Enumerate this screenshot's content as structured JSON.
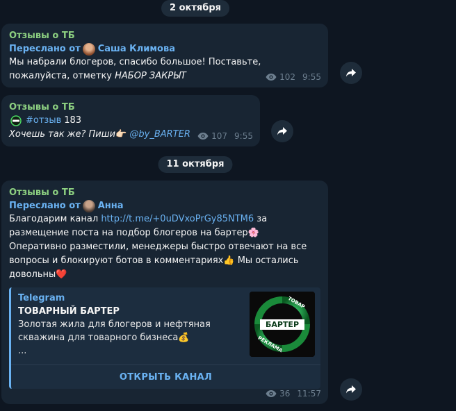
{
  "dates": [
    "2 октября",
    "11 октября"
  ],
  "messages": [
    {
      "sender": "Отзывы о ТБ",
      "forwarded_prefix": "Переслано от",
      "forwarded_name": "Саша Климова",
      "text_plain": "Мы набрали блогеров, спасибо большое! Поставьте, пожалуйста, отметку ",
      "text_italic": "НАБОР ЗАКРЫТ",
      "views": "102",
      "time": "9:55"
    },
    {
      "sender": "Отзывы о ТБ",
      "hashtag": "#отзыв",
      "number": "183",
      "italic_text": "Хочешь так же? Пиши",
      "emoji": "👉🏻",
      "mention": "@by_BARTER",
      "views": "107",
      "time": "9:55"
    },
    {
      "sender": "Отзывы о ТБ",
      "forwarded_prefix": "Переслано от",
      "forwarded_name": "Анна",
      "text_before_link": "Благодарим канал ",
      "link": "http://t.me/+0uDVxoPrGy85NTM6",
      "text_after_link": " за размещение поста на подбор блогеров на бартер🌸 Оперативно разместили, менеджеры быстро отвечают на все вопросы и блокируют ботов в комментариях👍 Мы остались довольны❤️",
      "preview": {
        "site": "Telegram",
        "title": "ТОВАРНЫЙ БАРТЕР",
        "description": "Золотая жила для блогеров и нефтяная скважина для товарного бизнеса💰",
        "ellipsis": "...",
        "button": "ОТКРЫТЬ КАНАЛ",
        "thumb_top": "ТОВАР",
        "thumb_mid": "БАРТЕР",
        "thumb_bottom": "РЕКЛАМА"
      },
      "views": "36",
      "time": "11:57"
    }
  ],
  "icons": {
    "eye": "eye-icon",
    "share": "share-icon"
  },
  "colors": {
    "background": "#0e1621",
    "bubble": "#182533",
    "sender": "#8dd081",
    "link": "#6ab2f2",
    "meta": "#6d7f8f"
  }
}
